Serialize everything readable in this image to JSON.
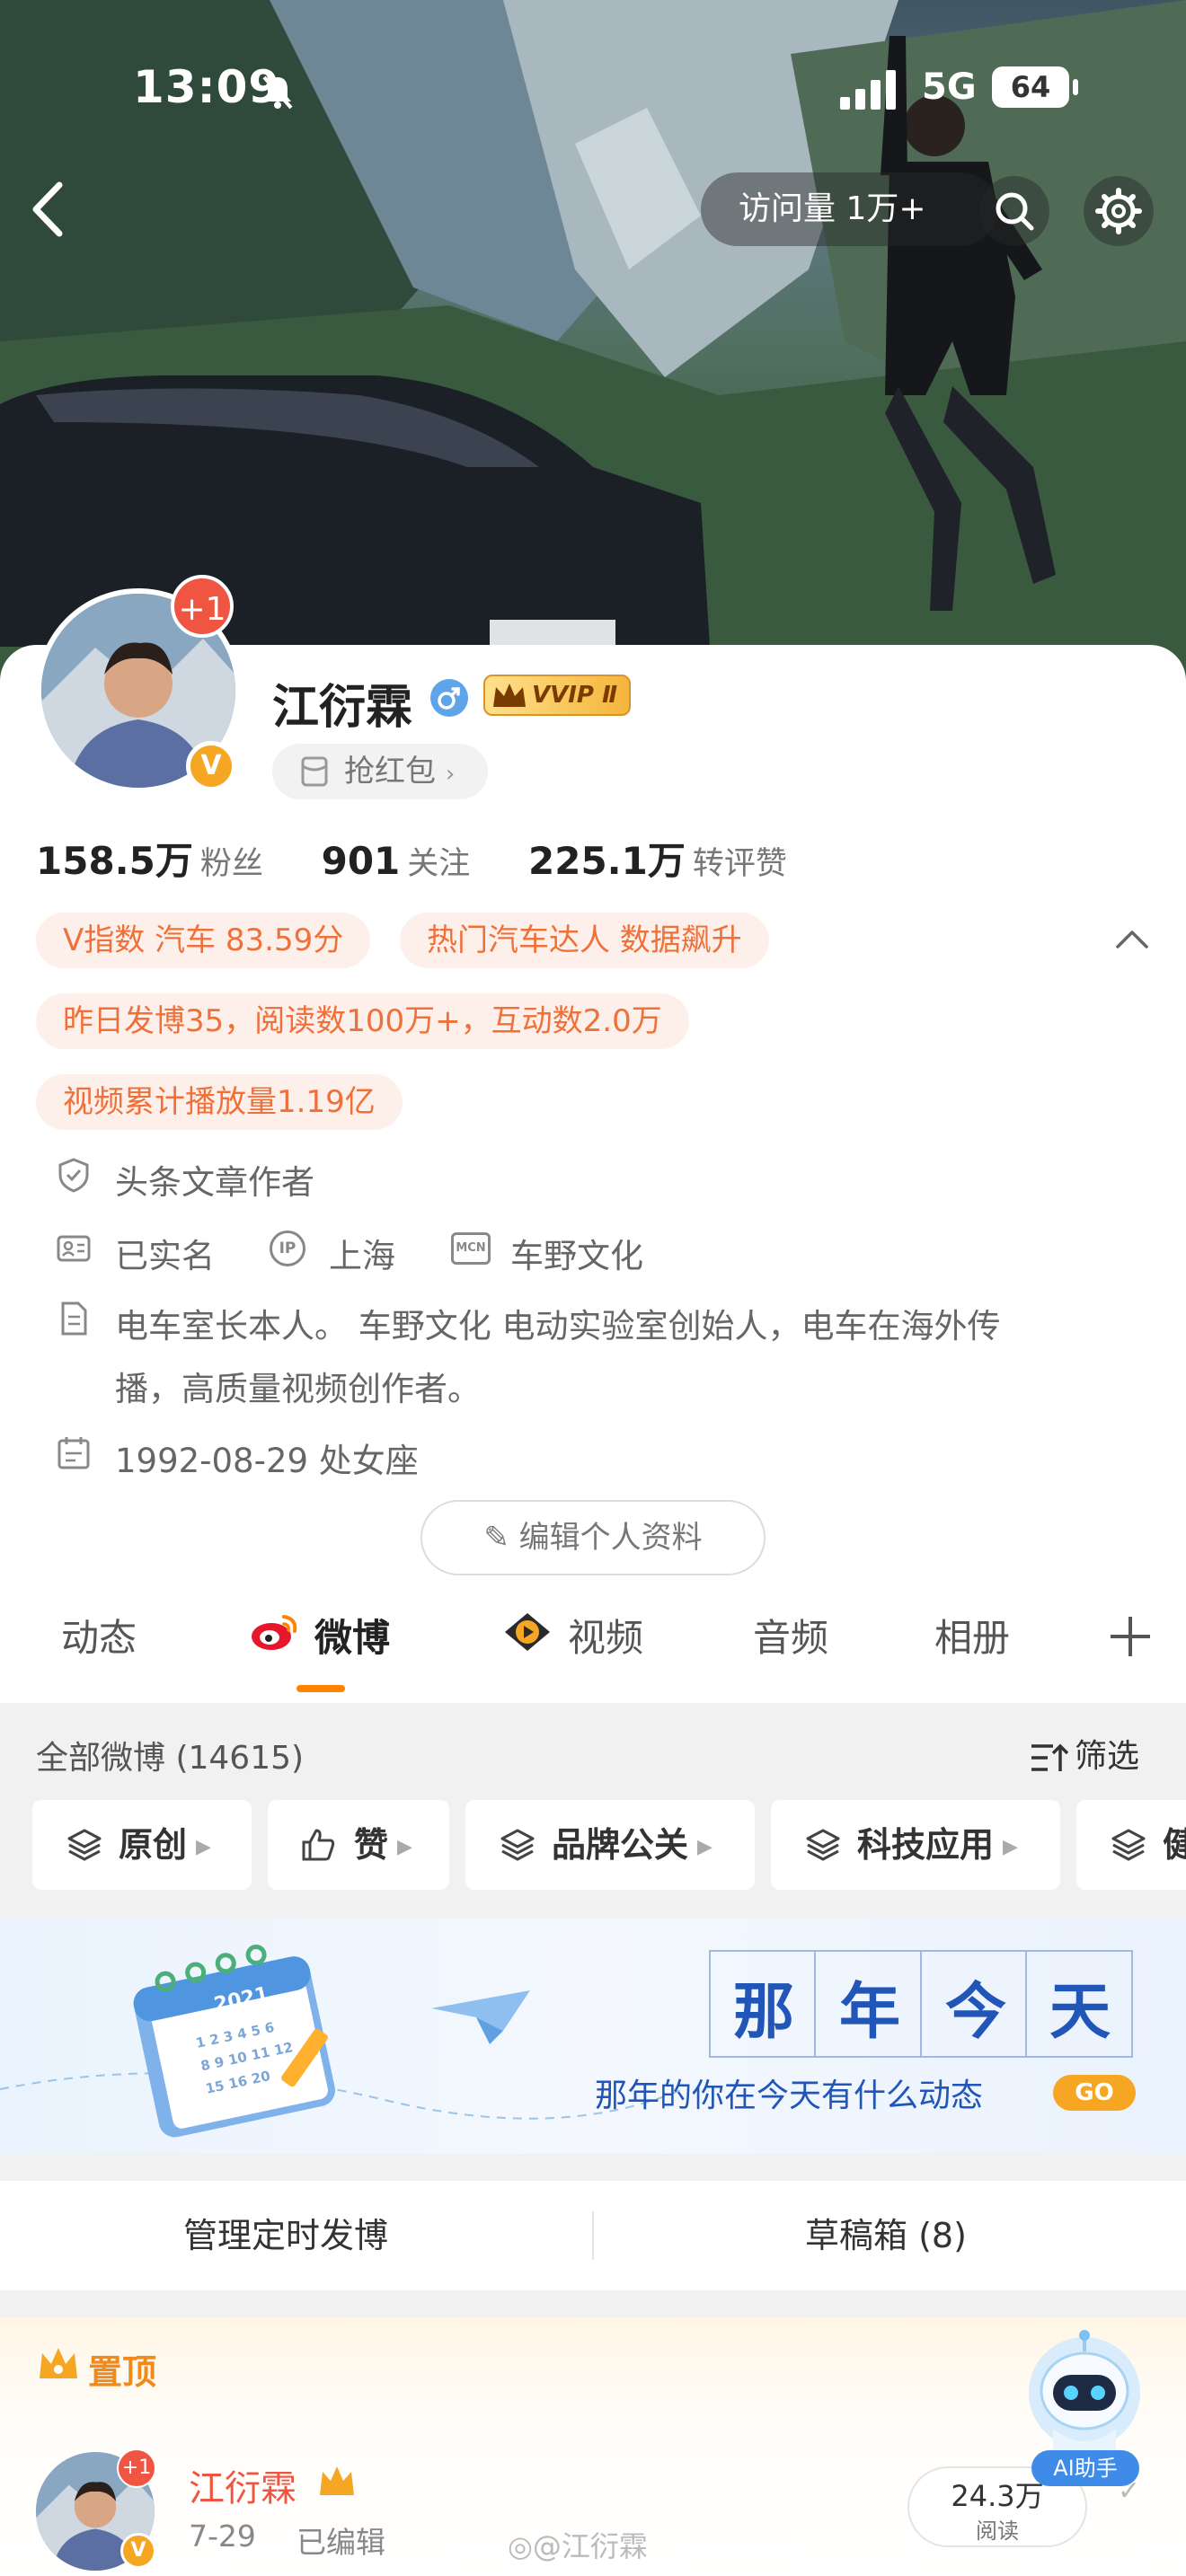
{
  "status_bar": {
    "time": "13:09",
    "network": "5G",
    "battery": "64"
  },
  "header": {
    "visits": "访问量 1万+",
    "back_icon": "chevron-left-icon",
    "search_icon": "search-icon",
    "settings_icon": "gear-icon"
  },
  "profile": {
    "name": "江衍霖",
    "avatar_badge": "+1",
    "verified_mark": "V",
    "vip": "VVIP Ⅱ",
    "red_packet": "抢红包",
    "stats": [
      {
        "value": "158.5万",
        "label": "粉丝"
      },
      {
        "value": "901",
        "label": "关注"
      },
      {
        "value": "225.1万",
        "label": "转评赞"
      }
    ],
    "tags": [
      "V指数 汽车 83.59分",
      "热门汽车达人 数据飙升",
      "昨日发博35，阅读数100万+，互动数2.0万",
      "视频累计播放量1.19亿"
    ],
    "info": {
      "author": "头条文章作者",
      "real_name": "已实名",
      "ip_label": "IP",
      "ip": "上海",
      "mcn_label": "MCN",
      "mcn": "车野文化",
      "bio_line1": "电车室长本人。 车野文化 电动实验室创始人，电车在海外传",
      "bio_line2": "播，高质量视频创作者。",
      "birthday": "1992-08-29 处女座"
    },
    "edit_button": "编辑个人资料"
  },
  "tabs": [
    "动态",
    "微博",
    "视频",
    "音频",
    "相册"
  ],
  "feed": {
    "title": "全部微博 (14615)",
    "filter": "筛选",
    "chips": [
      "原创",
      "赞",
      "品牌公关",
      "科技应用",
      "健"
    ],
    "banner": {
      "heading_chars": [
        "那",
        "年",
        "今",
        "天"
      ],
      "subtitle": "那年的你在今天有什么动态",
      "go": "GO",
      "calendar_year": "2021",
      "calendar_numbers": [
        "1",
        "2",
        "3",
        "4",
        "5",
        "6",
        "8",
        "9",
        "10",
        "11",
        "12",
        "15",
        "16",
        "20"
      ]
    },
    "schedule": "管理定时发博",
    "drafts": "草稿箱 (8)",
    "pinned_label": "置顶",
    "post": {
      "author": "江衍霖",
      "date": "7-29",
      "edited": "已编辑",
      "reads_value": "24.3万",
      "reads_label": "阅读",
      "avatar_badge": "+1"
    },
    "ai_assistant": "AI助手",
    "watermark": "@江衍霖"
  },
  "colors": {
    "accent": "#ff8200",
    "tag_text": "#f0703a",
    "tag_bg": "#fdf0ea",
    "verified": "#f5a623"
  }
}
